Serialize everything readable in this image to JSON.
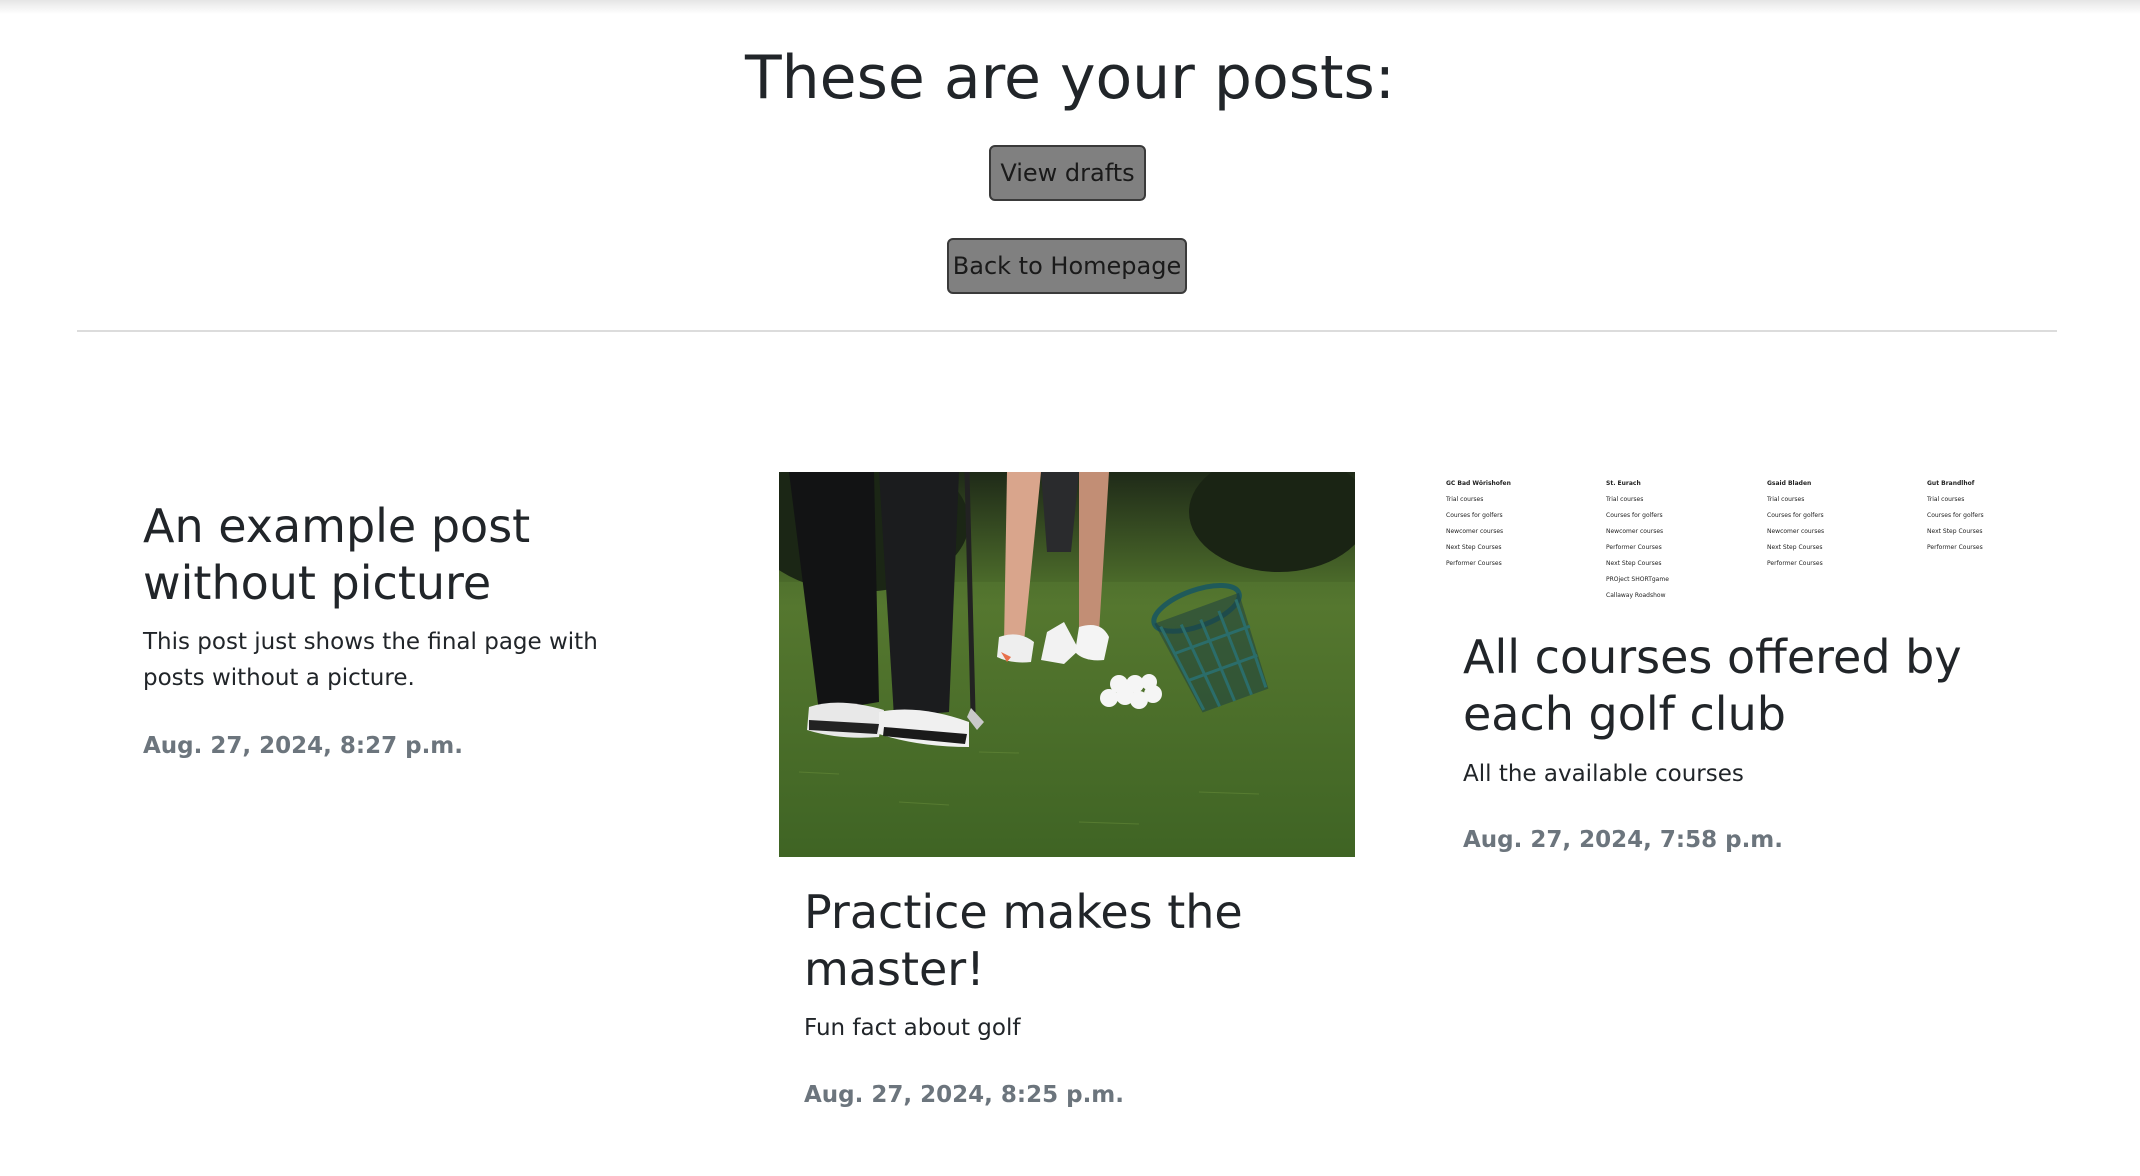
{
  "header": {
    "title": "These are your posts:",
    "view_drafts_label": "View drafts",
    "back_home_label": "Back to Homepage"
  },
  "posts": [
    {
      "title": "An example post without picture",
      "excerpt": "This post just shows the final page with posts without a picture.",
      "date": "Aug. 27, 2024, 8:27 p.m."
    },
    {
      "title": "Practice makes the master!",
      "excerpt": "Fun fact about golf",
      "date": "Aug. 27, 2024, 8:25 p.m.",
      "image": "golf-practice-photo"
    },
    {
      "title": "All courses offered by each golf club",
      "excerpt": "All the available courses",
      "date": "Aug. 27, 2024, 7:58 p.m.",
      "image_table": {
        "columns": [
          {
            "club": "GC Bad Wörishofen",
            "items": [
              "Trial courses",
              "Courses for golfers",
              "Newcomer courses",
              "Next Step Courses",
              "Performer Courses"
            ]
          },
          {
            "club": "St. Eurach",
            "items": [
              "Trial courses",
              "Courses for golfers",
              "Newcomer courses",
              "Performer Courses",
              "Next Step Courses",
              "PROject SHORTgame",
              "Callaway Roadshow"
            ]
          },
          {
            "club": "Gsaid Bladen",
            "items": [
              "Trial courses",
              "Courses for golfers",
              "Newcomer courses",
              "Next Step Courses",
              "Performer Courses"
            ]
          },
          {
            "club": "Gut Brandlhof",
            "items": [
              "Trial courses",
              "Courses for golfers",
              "Next Step Courses",
              "Performer Courses"
            ]
          }
        ]
      }
    }
  ]
}
